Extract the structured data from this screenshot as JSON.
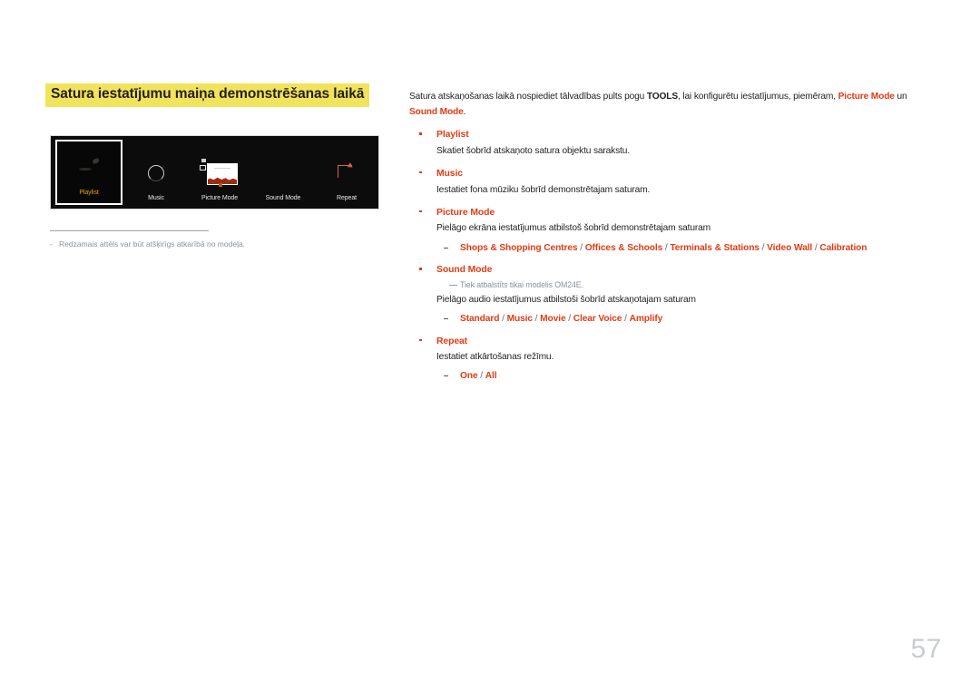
{
  "page": {
    "number": "57",
    "section_title": "Satura iestatījumu maiņa demonstrēšanas laikā"
  },
  "figure": {
    "device_items": [
      {
        "label": "Playlist",
        "icon": "playlist-thumbnail-icon",
        "selected": true
      },
      {
        "label": "Music",
        "icon": "music-circle-icon",
        "selected": false
      },
      {
        "label": "Picture Mode",
        "icon": "picture-mode-icon",
        "selected": false
      },
      {
        "label": "Sound Mode",
        "icon": "sound-mode-icon",
        "selected": false
      },
      {
        "label": "Repeat",
        "icon": "repeat-arrow-icon",
        "selected": false
      }
    ],
    "note_dash": "-",
    "note": "Redzamais attēls var būt atšķirīgs atkarībā no modeļa."
  },
  "intro": {
    "p1": "Satura atskaņošanas laikā nospiediet tālvadības pults pogu ",
    "tools": "TOOLS",
    "p2": ", lai konfigurētu iestatījumus, piemēram, ",
    "picture_mode": "Picture Mode",
    "p3": " un ",
    "sound_mode": "Sound Mode",
    "p4": "."
  },
  "items": [
    {
      "label": "Playlist",
      "desc": "Skatiet šobrīd atskaņoto satura objektu sarakstu."
    },
    {
      "label": "Music",
      "desc": "Iestatiet fona mūziku šobrīd demonstrētajam saturam."
    },
    {
      "label": "Picture Mode",
      "desc": "Pielāgo ekrāna iestatījumus atbilstoš šobrīd demonstrētajam saturam",
      "options": "Shops & Shopping Centres / Offices & Schools / Terminals & Stations / Video Wall / Calibration"
    },
    {
      "label": "Sound Mode",
      "note": "Tiek atbalstīts tikai modelis OM24E.",
      "desc": "Pielāgo audio iestatījumus atbilstoši šobrīd atskaņotajam saturam",
      "options": "Standard / Music / Movie / Clear Voice / Amplify"
    },
    {
      "label": "Repeat",
      "desc": "Iestatiet atkārtošanas režīmu.",
      "options": "One / All"
    }
  ],
  "colors": {
    "accent_red": "#e03c15",
    "highlight_yellow": "#f2e35c",
    "note_gray": "#8a929e",
    "selected_amber": "#e3a21a"
  }
}
